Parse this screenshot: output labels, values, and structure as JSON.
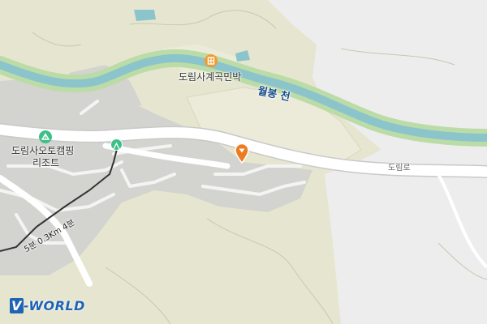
{
  "map": {
    "provider_logo": {
      "prefix": "V",
      "name": "-WORLD"
    },
    "labels": {
      "stream": "월봉 천",
      "road": "도림로",
      "pension": "도림사계곡민박",
      "camping_line1": "도림사오토캠핑",
      "camping_line2": "리조트",
      "walk_distance": "5분 0.3Km 4분"
    },
    "icons": {
      "pension": "building-icon",
      "camping": "camping-icon",
      "trailhead": "hiking-icon",
      "location": "location-pin-icon"
    },
    "colors": {
      "land": "#e6e6d0",
      "field": "#ecebd9",
      "open_area": "#ededee",
      "developed": "#d3d3d0",
      "road": "#ffffff",
      "river": "#8cc4cc",
      "river_bank": "#bbdca6",
      "poi_orange": "#f39a2b",
      "poi_green": "#3dbf88",
      "pin_orange": "#ec7c22",
      "logo_blue": "#1f63b5"
    }
  }
}
